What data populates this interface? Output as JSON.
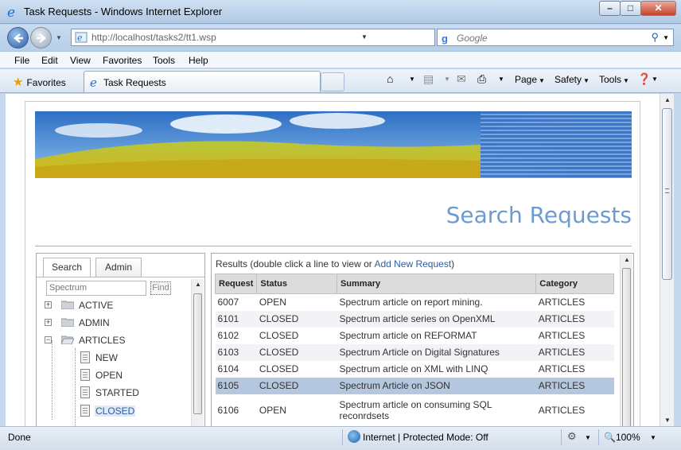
{
  "window": {
    "title": "Task Requests - Windows Internet Explorer"
  },
  "address_bar": {
    "url": "http://localhost/tasks2/tt1.wsp"
  },
  "search_bar": {
    "placeholder": "Google"
  },
  "menu": [
    "File",
    "Edit",
    "View",
    "Favorites",
    "Tools",
    "Help"
  ],
  "favorites_label": "Favorites",
  "tab": {
    "title": "Task Requests"
  },
  "command_bar": {
    "page": "Page",
    "safety": "Safety",
    "tools": "Tools"
  },
  "page": {
    "heading": "Search Requests",
    "left_tabs": {
      "search": "Search",
      "admin": "Admin"
    },
    "finder": {
      "placeholder": "Spectrum",
      "button": "Find"
    },
    "tree": {
      "folders": [
        "ACTIVE",
        "ADMIN",
        "ARTICLES"
      ],
      "children": [
        "NEW",
        "OPEN",
        "STARTED",
        "CLOSED"
      ],
      "selected": "CLOSED"
    },
    "results": {
      "prefix": "Results (double click a line to view or ",
      "link": "Add New Request",
      "suffix": ")",
      "columns": [
        "Request",
        "Status",
        "Summary",
        "Category"
      ],
      "rows": [
        {
          "request": "6007",
          "status": "OPEN",
          "summary": "Spectrum article on report mining.",
          "category": "ARTICLES"
        },
        {
          "request": "6101",
          "status": "CLOSED",
          "summary": "Spectrum article series on OpenXML",
          "category": "ARTICLES"
        },
        {
          "request": "6102",
          "status": "CLOSED",
          "summary": "Spectrum article on REFORMAT",
          "category": "ARTICLES"
        },
        {
          "request": "6103",
          "status": "CLOSED",
          "summary": "Spectrum Article on Digital Signatures",
          "category": "ARTICLES"
        },
        {
          "request": "6104",
          "status": "CLOSED",
          "summary": "Spectrum article on XML with LINQ",
          "category": "ARTICLES"
        },
        {
          "request": "6105",
          "status": "CLOSED",
          "summary": "Spectrum Article on JSON",
          "category": "ARTICLES"
        },
        {
          "request": "6106",
          "status": "OPEN",
          "summary": "Spectrum article on consuming SQL reconrdsets",
          "category": "ARTICLES"
        }
      ],
      "selected_request": "6105"
    }
  },
  "status_bar": {
    "text": "Done",
    "zone": "Internet | Protected Mode: Off",
    "zoom": "100%"
  }
}
